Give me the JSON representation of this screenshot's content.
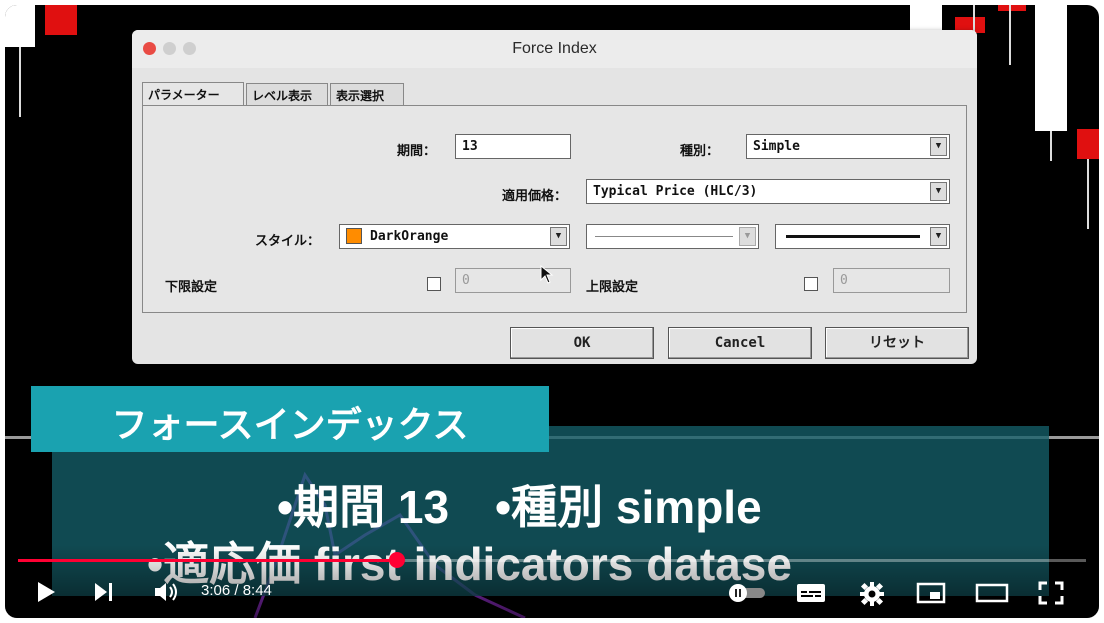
{
  "dialog": {
    "title": "Force Index",
    "tabs": [
      "パラメーター",
      "レベル表示",
      "表示選択"
    ],
    "period": {
      "label": "期間：",
      "value": "13"
    },
    "kind": {
      "label": "種別：",
      "value": "Simple"
    },
    "applied_price": {
      "label": "適用価格：",
      "value": "Typical Price (HLC/3)"
    },
    "style": {
      "label": "スタイル：",
      "color_name": "DarkOrange",
      "color": "#ff8c00"
    },
    "lower_level": {
      "label": "下限設定",
      "value": "0",
      "checked": false
    },
    "upper_level": {
      "label": "上限設定",
      "value": "0",
      "checked": false
    },
    "buttons": {
      "ok": "OK",
      "cancel": "Cancel",
      "reset": "リセット"
    }
  },
  "overlay": {
    "banner": "フォースインデックス",
    "line1": "•期間 13　•種別 simple",
    "line2": "•適応価 first indicators datase"
  },
  "player": {
    "time": "3:06 / 8:44",
    "progress": 0.355,
    "colors": {
      "accent": "#ff0033",
      "banner": "#1aa2b0"
    },
    "icons": [
      "play-icon",
      "next-icon",
      "volume-icon",
      "autoplay-toggle-icon",
      "subtitles-icon",
      "settings-icon",
      "miniplayer-icon",
      "theater-icon",
      "fullscreen-icon"
    ]
  }
}
